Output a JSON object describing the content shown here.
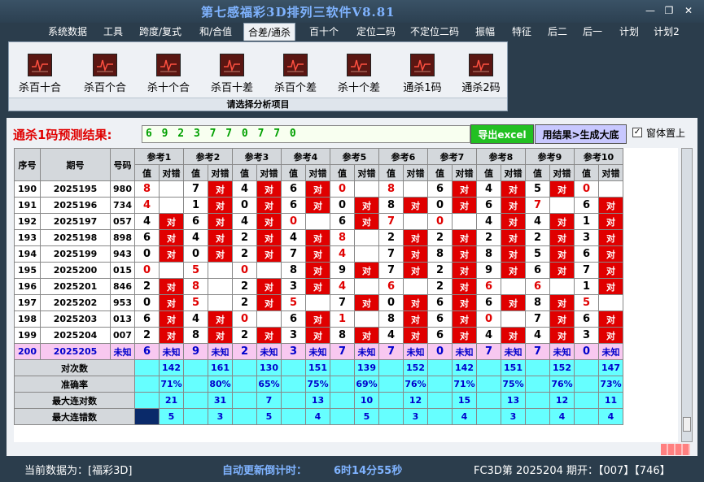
{
  "window": {
    "title": "第七感福彩3D排列三软件V8.81",
    "minimize": "—",
    "restore": "❐",
    "close": "✕"
  },
  "menu": [
    "系统数据",
    "工具",
    "跨度/复式",
    "和/合值",
    "合差/通杀",
    "百十个",
    "定位二码",
    "不定位二码",
    "振幅",
    "特征",
    "后二",
    "后一",
    "计划",
    "计划2"
  ],
  "active_menu": 4,
  "ribbon": {
    "buttons": [
      "杀百十合",
      "杀百个合",
      "杀十个合",
      "杀百十差",
      "杀百个差",
      "杀十个差",
      "通杀1码",
      "通杀2码"
    ],
    "caption": "请选择分析项目"
  },
  "prediction": {
    "label": "通杀1码预测结果:",
    "value": "6 9 2 3 7 7 0 7 7 0"
  },
  "buttons": {
    "export": "导出excel",
    "generate": "用结果>生成大底",
    "topmost": "窗体置上"
  },
  "table": {
    "headers": {
      "seq": "序号",
      "period": "期号",
      "code": "号码",
      "refs": [
        "参考1",
        "参考2",
        "参考3",
        "参考4",
        "参考5",
        "参考6",
        "参考7",
        "参考8",
        "参考9",
        "参考10"
      ],
      "val": "值",
      "hit": "对错"
    },
    "rows": [
      {
        "seq": "190",
        "period": "2025195",
        "code": "980",
        "v": [
          "8",
          "7",
          "4",
          "6",
          "0",
          "8",
          "6",
          "4",
          "5",
          "0"
        ],
        "h": [
          0,
          1,
          1,
          1,
          0,
          0,
          1,
          1,
          1,
          0
        ],
        "red": [
          1,
          0,
          0,
          0,
          1,
          1,
          0,
          0,
          0,
          1
        ]
      },
      {
        "seq": "191",
        "period": "2025196",
        "code": "734",
        "v": [
          "4",
          "1",
          "0",
          "6",
          "0",
          "8",
          "0",
          "6",
          "7",
          "6"
        ],
        "h": [
          0,
          1,
          1,
          1,
          1,
          1,
          1,
          1,
          0,
          1
        ],
        "red": [
          1,
          0,
          0,
          0,
          0,
          0,
          0,
          0,
          1,
          0
        ]
      },
      {
        "seq": "192",
        "period": "2025197",
        "code": "057",
        "v": [
          "4",
          "6",
          "4",
          "0",
          "6",
          "7",
          "0",
          "4",
          "4",
          "1"
        ],
        "h": [
          1,
          1,
          1,
          0,
          1,
          0,
          0,
          1,
          1,
          1
        ],
        "red": [
          0,
          0,
          0,
          1,
          0,
          1,
          1,
          0,
          0,
          0
        ]
      },
      {
        "seq": "193",
        "period": "2025198",
        "code": "898",
        "v": [
          "6",
          "4",
          "2",
          "4",
          "8",
          "2",
          "2",
          "2",
          "2",
          "3"
        ],
        "h": [
          1,
          1,
          1,
          1,
          0,
          1,
          1,
          1,
          1,
          1
        ],
        "red": [
          0,
          0,
          0,
          0,
          1,
          0,
          0,
          0,
          0,
          0
        ]
      },
      {
        "seq": "194",
        "period": "2025199",
        "code": "943",
        "v": [
          "0",
          "0",
          "2",
          "7",
          "4",
          "7",
          "8",
          "8",
          "5",
          "6"
        ],
        "h": [
          1,
          1,
          1,
          1,
          0,
          1,
          1,
          1,
          1,
          1
        ],
        "red": [
          0,
          0,
          0,
          0,
          1,
          0,
          0,
          0,
          0,
          0
        ]
      },
      {
        "seq": "195",
        "period": "2025200",
        "code": "015",
        "v": [
          "0",
          "5",
          "0",
          "8",
          "9",
          "7",
          "2",
          "9",
          "6",
          "7"
        ],
        "h": [
          0,
          0,
          0,
          1,
          1,
          1,
          1,
          1,
          1,
          1
        ],
        "red": [
          1,
          1,
          1,
          0,
          0,
          0,
          0,
          0,
          0,
          0
        ]
      },
      {
        "seq": "196",
        "period": "2025201",
        "code": "846",
        "v": [
          "2",
          "8",
          "2",
          "3",
          "4",
          "6",
          "2",
          "6",
          "6",
          "1"
        ],
        "h": [
          1,
          0,
          1,
          1,
          0,
          0,
          1,
          0,
          0,
          1
        ],
        "red": [
          0,
          1,
          0,
          0,
          1,
          1,
          0,
          1,
          1,
          0
        ]
      },
      {
        "seq": "197",
        "period": "2025202",
        "code": "953",
        "v": [
          "0",
          "5",
          "2",
          "5",
          "7",
          "0",
          "6",
          "6",
          "8",
          "5"
        ],
        "h": [
          1,
          0,
          1,
          0,
          1,
          1,
          1,
          1,
          1,
          0
        ],
        "red": [
          0,
          1,
          0,
          1,
          0,
          0,
          0,
          0,
          0,
          1
        ]
      },
      {
        "seq": "198",
        "period": "2025203",
        "code": "013",
        "v": [
          "6",
          "4",
          "0",
          "6",
          "1",
          "8",
          "6",
          "0",
          "7",
          "6"
        ],
        "h": [
          1,
          1,
          0,
          1,
          0,
          1,
          1,
          0,
          1,
          1
        ],
        "red": [
          0,
          0,
          1,
          0,
          1,
          0,
          0,
          1,
          0,
          0
        ]
      },
      {
        "seq": "199",
        "period": "2025204",
        "code": "007",
        "v": [
          "2",
          "8",
          "2",
          "3",
          "8",
          "4",
          "6",
          "4",
          "4",
          "3"
        ],
        "h": [
          1,
          1,
          1,
          1,
          1,
          1,
          1,
          1,
          1,
          1
        ],
        "red": [
          0,
          0,
          0,
          0,
          0,
          0,
          0,
          0,
          0,
          0
        ]
      },
      {
        "seq": "200",
        "period": "2025205",
        "code": "未知",
        "v": [
          "6",
          "9",
          "2",
          "3",
          "7",
          "7",
          "0",
          "7",
          "7",
          "0"
        ],
        "h": [
          2,
          2,
          2,
          2,
          2,
          2,
          2,
          2,
          2,
          2
        ],
        "red": [
          0,
          0,
          0,
          0,
          0,
          0,
          0,
          0,
          0,
          0
        ]
      }
    ],
    "unknown": "未知",
    "hit_mark": "对",
    "stats": [
      {
        "label": "对次数",
        "values": [
          "142",
          "161",
          "130",
          "151",
          "139",
          "152",
          "142",
          "151",
          "152",
          "147"
        ]
      },
      {
        "label": "准确率",
        "values": [
          "71%",
          "80%",
          "65%",
          "75%",
          "69%",
          "76%",
          "71%",
          "75%",
          "76%",
          "73%"
        ]
      },
      {
        "label": "最大连对数",
        "values": [
          "21",
          "31",
          "7",
          "13",
          "10",
          "12",
          "15",
          "13",
          "12",
          "11"
        ]
      },
      {
        "label": "最大连错数",
        "values": [
          "5",
          "3",
          "5",
          "4",
          "5",
          "3",
          "4",
          "3",
          "4",
          "4"
        ]
      }
    ]
  },
  "status": {
    "current": "当前数据为：[福彩3D]",
    "countdown_label": "自动更新倒计时：",
    "countdown": "6时14分55秒",
    "latest": "FC3D第 2025204 期开：【007】【746】"
  }
}
